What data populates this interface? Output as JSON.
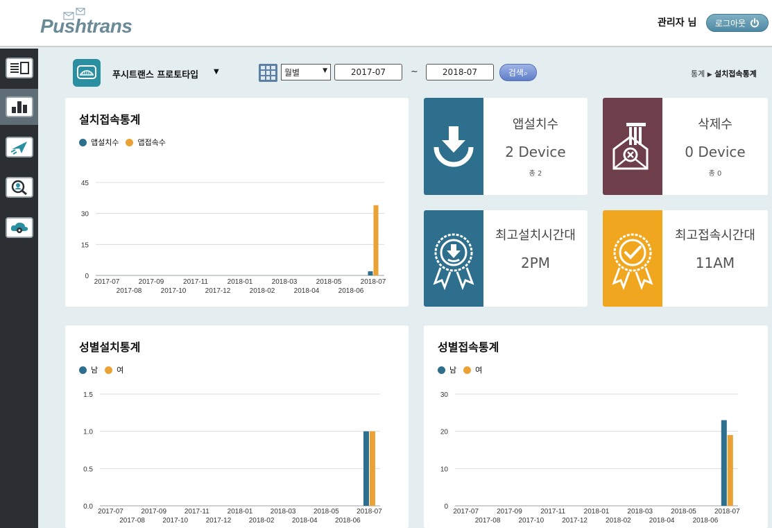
{
  "header": {
    "logo_text": "Pushtrans",
    "admin_label": "관리자 님",
    "logout_label": "로그아웃"
  },
  "sidebar": {
    "items": [
      {
        "icon": "list-panel-icon"
      },
      {
        "icon": "bar-chart-icon",
        "active": true
      },
      {
        "icon": "paper-plane-icon"
      },
      {
        "icon": "user-search-icon"
      },
      {
        "icon": "cloud-gear-icon"
      }
    ]
  },
  "toolbar": {
    "app_name": "푸시트랜스 프로토타입",
    "period": "월별",
    "date_from": "2017-07",
    "date_to": "2018-07",
    "tilde": "~",
    "search_label": "검색",
    "breadcrumb_parent": "통계",
    "breadcrumb_current": "설치접속통계"
  },
  "colors": {
    "blue": "#2d6f8c",
    "orange": "#eaa234",
    "maroon": "#6f3e4b",
    "card_blue": "#2d6f8c",
    "card_orange": "#f0a71f"
  },
  "stats": {
    "install": {
      "label": "앱설치수",
      "value": "2 Device",
      "sub": "총 2"
    },
    "delete": {
      "label": "삭제수",
      "value": "0 Device",
      "sub": "총 0"
    },
    "peak_install": {
      "label": "최고설치시간대",
      "value": "2PM"
    },
    "peak_access": {
      "label": "최고접속시간대",
      "value": "11AM"
    }
  },
  "panels": {
    "install_access": {
      "title": "설치접속통계",
      "legend": [
        "앱설치수",
        "앱접속수"
      ]
    },
    "gender_install": {
      "title": "성별설치통계",
      "legend": [
        "남",
        "여"
      ]
    },
    "gender_access": {
      "title": "성별접속통계",
      "legend": [
        "남",
        "여"
      ]
    }
  },
  "chart_data": [
    {
      "type": "bar",
      "title": "설치접속통계",
      "categories": [
        "2017-07",
        "2017-08",
        "2017-09",
        "2017-10",
        "2017-11",
        "2017-12",
        "2018-01",
        "2018-02",
        "2018-03",
        "2018-04",
        "2018-05",
        "2018-06",
        "2018-07"
      ],
      "series": [
        {
          "name": "앱설치수",
          "values": [
            0,
            0,
            0,
            0,
            0,
            0,
            0,
            0,
            0,
            0,
            0,
            0,
            2
          ]
        },
        {
          "name": "앱접속수",
          "values": [
            0,
            0,
            0,
            0,
            0,
            0,
            0,
            0,
            0,
            0,
            0,
            0,
            34
          ]
        }
      ],
      "yticks": [
        0,
        15,
        30,
        45
      ],
      "ylim": [
        0,
        45
      ],
      "grid": true
    },
    {
      "type": "bar",
      "title": "성별설치통계",
      "categories": [
        "2017-07",
        "2017-08",
        "2017-09",
        "2017-10",
        "2017-11",
        "2017-12",
        "2018-01",
        "2018-02",
        "2018-03",
        "2018-04",
        "2018-05",
        "2018-06",
        "2018-07"
      ],
      "series": [
        {
          "name": "남",
          "values": [
            0,
            0,
            0,
            0,
            0,
            0,
            0,
            0,
            0,
            0,
            0,
            0,
            1
          ]
        },
        {
          "name": "여",
          "values": [
            0,
            0,
            0,
            0,
            0,
            0,
            0,
            0,
            0,
            0,
            0,
            0,
            1
          ]
        }
      ],
      "yticks": [
        "0.0",
        "0.5",
        "1.0",
        "1.5"
      ],
      "ylim": [
        0,
        1.5
      ],
      "grid": true
    },
    {
      "type": "bar",
      "title": "성별접속통계",
      "categories": [
        "2017-07",
        "2017-08",
        "2017-09",
        "2017-10",
        "2017-11",
        "2017-12",
        "2018-01",
        "2018-02",
        "2018-03",
        "2018-04",
        "2018-05",
        "2018-06",
        "2018-07"
      ],
      "series": [
        {
          "name": "남",
          "values": [
            0,
            0,
            0,
            0,
            0,
            0,
            0,
            0,
            0,
            0,
            0,
            0,
            23
          ]
        },
        {
          "name": "여",
          "values": [
            0,
            0,
            0,
            0,
            0,
            0,
            0,
            0,
            0,
            0,
            0,
            0,
            19
          ]
        }
      ],
      "yticks": [
        0,
        10,
        20,
        30
      ],
      "ylim": [
        0,
        30
      ],
      "grid": true
    }
  ]
}
